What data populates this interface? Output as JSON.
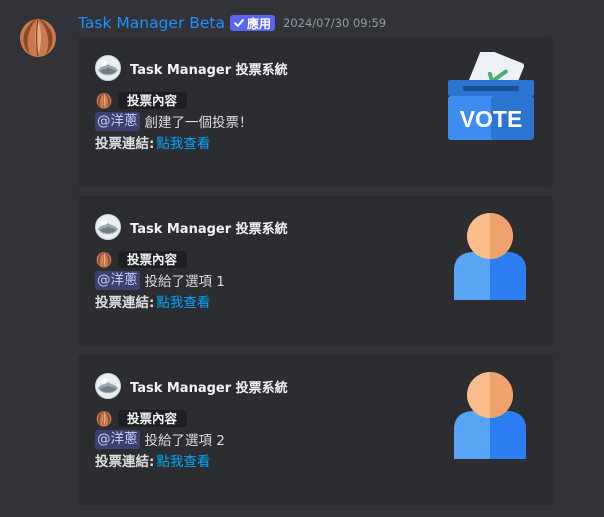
{
  "message": {
    "author": "Task Manager Beta",
    "badge": "應用",
    "timestamp": "2024/07/30 09:59"
  },
  "embeds": [
    {
      "author": "Task Manager 投票系統",
      "tag": "投票內容",
      "mention": "@洋蔥",
      "action": "創建了一個投票！",
      "link_label": "投票連結:",
      "link_text": "點我查看",
      "thumbnail": "vote-box-icon",
      "thumbnail_text": "VOTE"
    },
    {
      "author": "Task Manager 投票系統",
      "tag": "投票內容",
      "mention": "@洋蔥",
      "action": "投給了選項 1",
      "link_label": "投票連結:",
      "link_text": "點我查看",
      "thumbnail": "user-avatar-icon"
    },
    {
      "author": "Task Manager 投票系統",
      "tag": "投票內容",
      "mention": "@洋蔥",
      "action": "投給了選項 2",
      "link_label": "投票連結:",
      "link_text": "點我查看",
      "thumbnail": "user-avatar-icon"
    }
  ],
  "colors": {
    "background": "#313338",
    "embed": "#2b2d31",
    "author": "#1e90ff",
    "badge": "#5865f2",
    "link": "#00a8fc",
    "mention": "#3c4270"
  }
}
